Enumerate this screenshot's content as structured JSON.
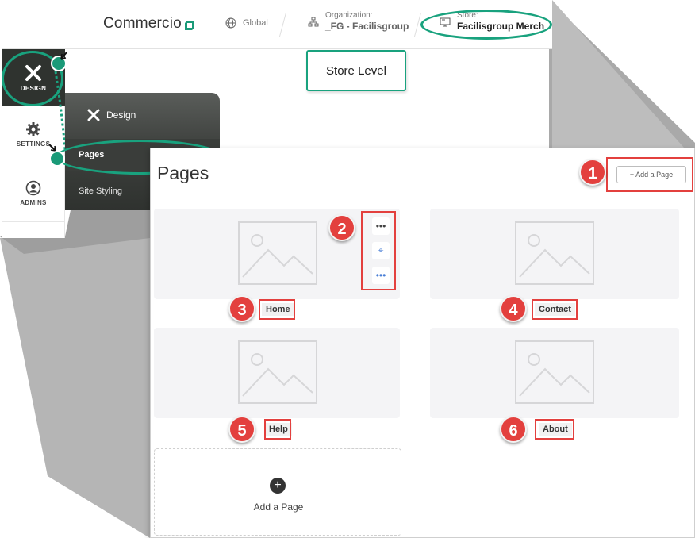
{
  "header": {
    "logo": "Commercio",
    "global_label": "Global",
    "org_label": "Organization:",
    "org_value": "_FG - Facilisgroup",
    "store_label": "Store:",
    "store_value": "Facilisgroup Merch"
  },
  "callout": {
    "text": "Store Level"
  },
  "rail": {
    "design": "DESIGN",
    "settings": "SETTINGS",
    "admins": "ADMINS"
  },
  "flyout": {
    "title": "Design",
    "items": [
      "Pages",
      "Site Styling"
    ]
  },
  "panel": {
    "title": "Pages",
    "add_button": "+ Add a Page",
    "cards": [
      {
        "label": "Home"
      },
      {
        "label": "Contact"
      },
      {
        "label": "Help"
      },
      {
        "label": "About"
      }
    ],
    "card_menu": {
      "more": "•••",
      "focus": "⌖",
      "options": "•••"
    },
    "add_card_label": "Add a Page",
    "add_card_icon": "+"
  },
  "badges": [
    "1",
    "2",
    "3",
    "4",
    "5",
    "6"
  ],
  "colors": {
    "accent_teal": "#19a27e",
    "annotation_red": "#e3403e",
    "rail_dark": "#2f332f"
  }
}
